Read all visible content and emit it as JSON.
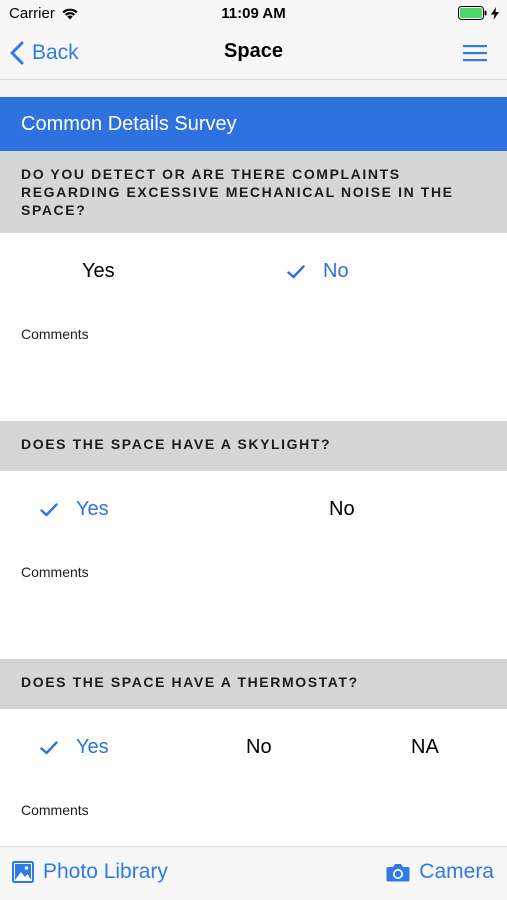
{
  "status_bar": {
    "carrier": "Carrier",
    "time": "11:09 AM"
  },
  "nav": {
    "back_label": "Back",
    "title": "Space"
  },
  "survey": {
    "header": "Common Details Survey"
  },
  "questions": [
    {
      "text": "DO YOU DETECT OR ARE THERE COMPLAINTS REGARDING EXCESSIVE MECHANICAL NOISE IN THE SPACE?",
      "options": [
        "Yes",
        "No"
      ],
      "selected": "No",
      "comments_label": "Comments"
    },
    {
      "text": "DOES THE SPACE HAVE A SKYLIGHT?",
      "options": [
        "Yes",
        "No"
      ],
      "selected": "Yes",
      "comments_label": "Comments"
    },
    {
      "text": "DOES THE SPACE HAVE A THERMOSTAT?",
      "options": [
        "Yes",
        "No",
        "NA"
      ],
      "selected": "Yes",
      "comments_label": "Comments"
    }
  ],
  "toolbar": {
    "photo_library_label": "Photo Library",
    "camera_label": "Camera"
  },
  "colors": {
    "accent": "#2f72df",
    "header_bg": "#2f72df",
    "question_bg": "#d6d6d6",
    "battery": "#4cd964"
  }
}
